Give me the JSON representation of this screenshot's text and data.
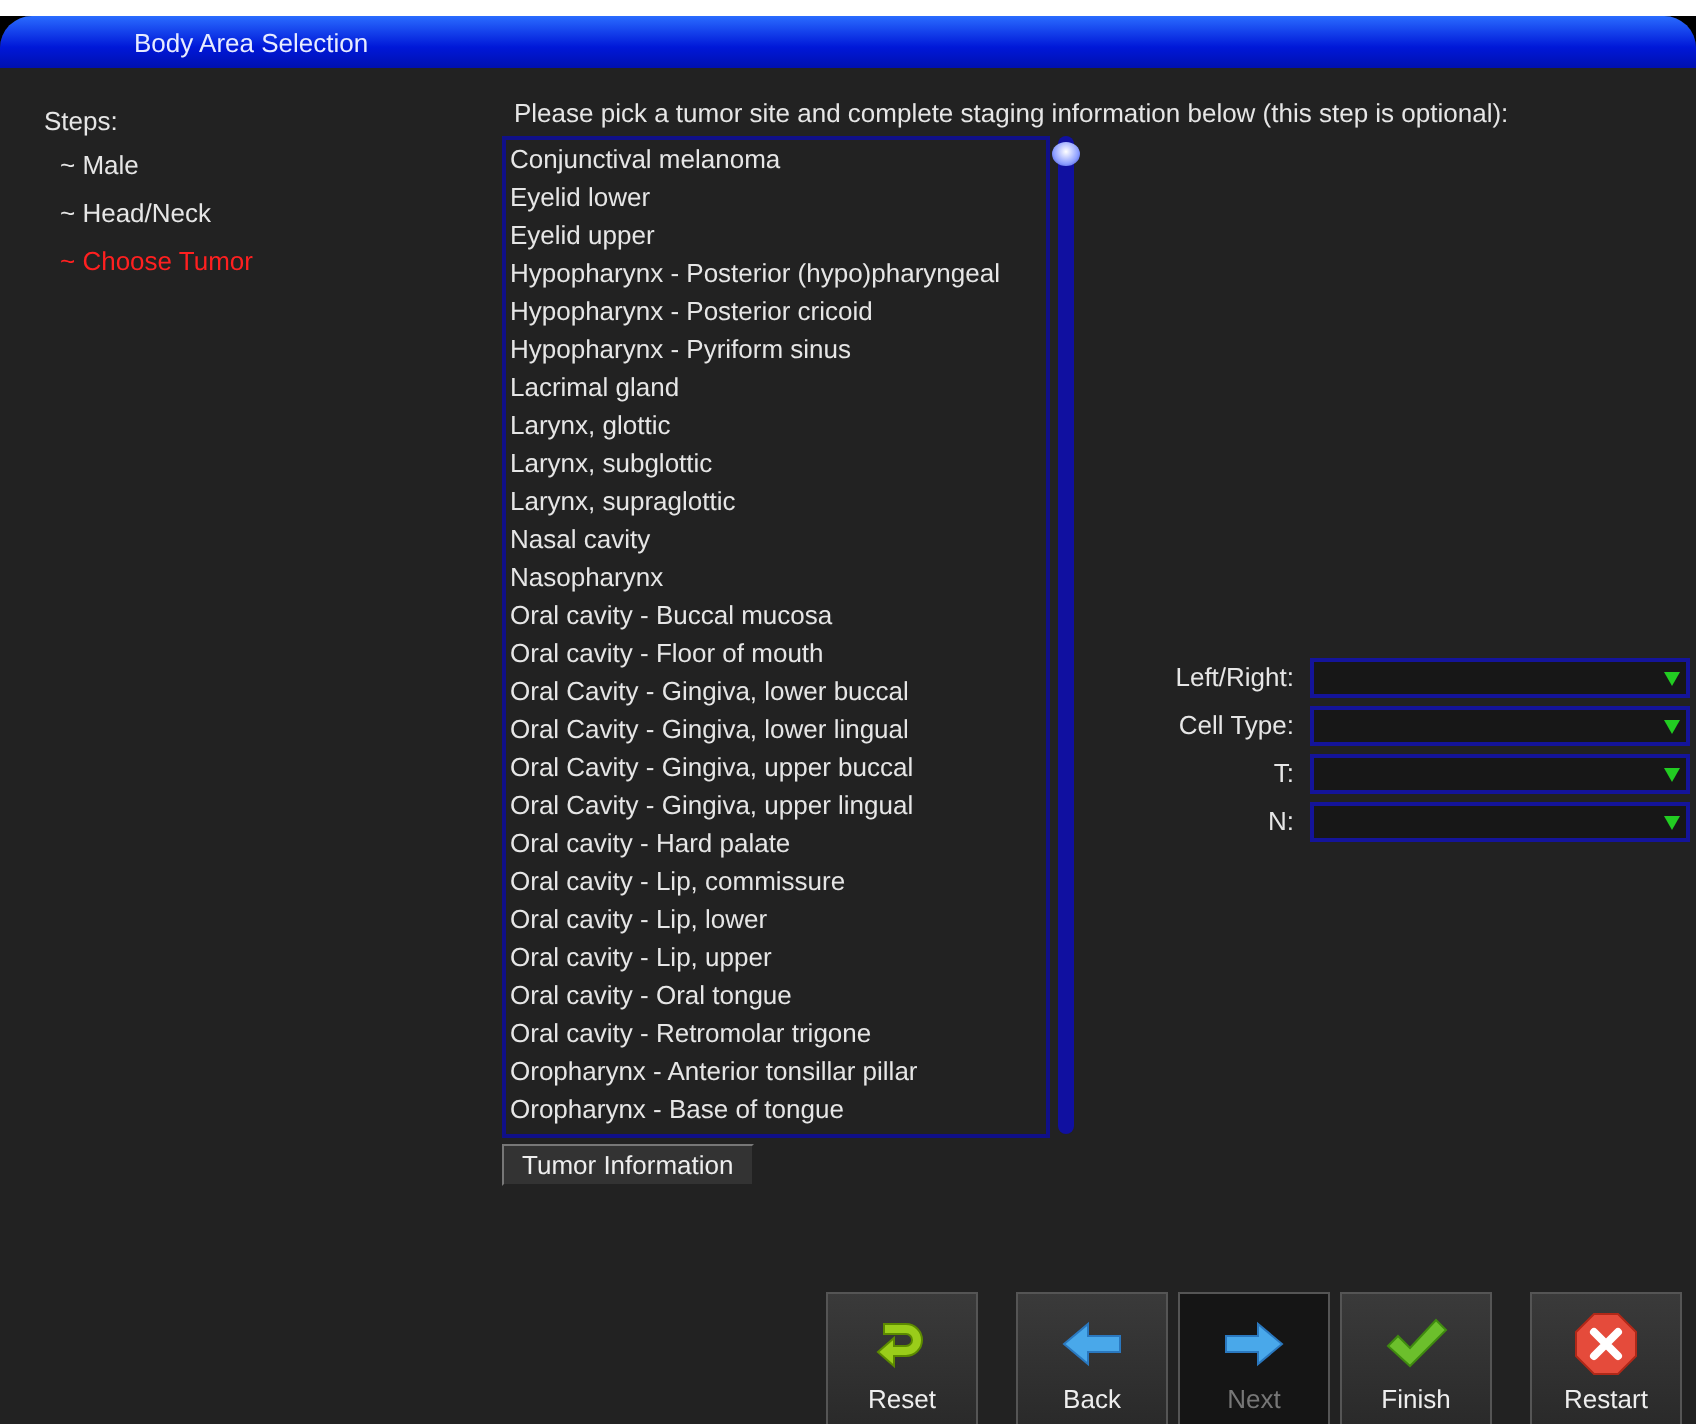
{
  "window": {
    "title": "Body Area Selection"
  },
  "steps": {
    "label": "Steps:",
    "items": [
      {
        "label": "~ Male",
        "current": false
      },
      {
        "label": "~ Head/Neck",
        "current": false
      },
      {
        "label": "~ Choose Tumor",
        "current": true
      }
    ]
  },
  "instruction": "Please pick a tumor site and complete staging information below (this step is optional):",
  "tumor_sites": [
    {
      "label": "Conjunctival melanoma",
      "selected": false
    },
    {
      "label": "Eyelid lower",
      "selected": false
    },
    {
      "label": "Eyelid upper",
      "selected": false
    },
    {
      "label": "Hypopharynx - Posterior (hypo)pharyngeal",
      "selected": false
    },
    {
      "label": "Hypopharynx - Posterior cricoid",
      "selected": false
    },
    {
      "label": "Hypopharynx - Pyriform sinus",
      "selected": false
    },
    {
      "label": "Lacrimal gland",
      "selected": false
    },
    {
      "label": "Larynx, glottic",
      "selected": false
    },
    {
      "label": "Larynx, subglottic",
      "selected": false
    },
    {
      "label": "Larynx, supraglottic",
      "selected": false
    },
    {
      "label": "Nasal cavity",
      "selected": false
    },
    {
      "label": "Nasopharynx",
      "selected": false
    },
    {
      "label": "Oral cavity - Buccal mucosa",
      "selected": false
    },
    {
      "label": "Oral cavity - Floor of mouth",
      "selected": false
    },
    {
      "label": "Oral Cavity - Gingiva, lower buccal",
      "selected": false
    },
    {
      "label": "Oral Cavity - Gingiva, lower lingual",
      "selected": false
    },
    {
      "label": "Oral Cavity - Gingiva, upper buccal",
      "selected": false
    },
    {
      "label": "Oral Cavity - Gingiva, upper lingual",
      "selected": false
    },
    {
      "label": "Oral cavity - Hard palate",
      "selected": false
    },
    {
      "label": "Oral cavity - Lip, commissure",
      "selected": false
    },
    {
      "label": "Oral cavity - Lip, lower",
      "selected": false
    },
    {
      "label": "Oral cavity - Lip, upper",
      "selected": false
    },
    {
      "label": "Oral cavity - Oral tongue",
      "selected": false
    },
    {
      "label": "Oral cavity - Retromolar trigone",
      "selected": false
    },
    {
      "label": "Oropharynx - Anterior tonsillar pillar",
      "selected": false
    },
    {
      "label": "Oropharynx - Base of tongue",
      "selected": false
    }
  ],
  "tumor_info_button": "Tumor Information",
  "staging_fields": [
    {
      "label": "Left/Right:"
    },
    {
      "label": "Cell Type:"
    },
    {
      "label": "T:"
    },
    {
      "label": "N:"
    }
  ],
  "nav_buttons": [
    {
      "kind": "reset",
      "label": "Reset",
      "disabled": false
    },
    {
      "kind": "back",
      "label": "Back",
      "disabled": false
    },
    {
      "kind": "next",
      "label": "Next",
      "disabled": true
    },
    {
      "kind": "finish",
      "label": "Finish",
      "disabled": false
    },
    {
      "kind": "restart",
      "label": "Restart",
      "disabled": false
    }
  ]
}
